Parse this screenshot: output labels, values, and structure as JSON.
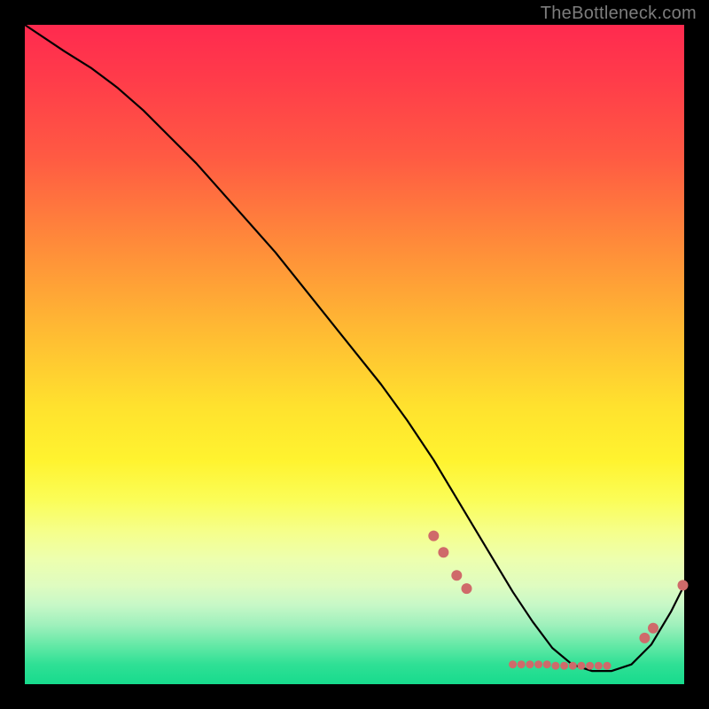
{
  "watermark": "TheBottleneck.com",
  "chart_data": {
    "type": "line",
    "title": "",
    "xlabel": "",
    "ylabel": "",
    "xlim": [
      0,
      100
    ],
    "ylim": [
      0,
      100
    ],
    "curve": {
      "name": "bottleneck-curve",
      "x": [
        0,
        6,
        10,
        14,
        18,
        22,
        26,
        30,
        34,
        38,
        42,
        46,
        50,
        54,
        58,
        62,
        65,
        68,
        71,
        74,
        77,
        80,
        83,
        86,
        89,
        92,
        95,
        98,
        100
      ],
      "y": [
        100,
        96,
        93.5,
        90.5,
        87,
        83,
        79,
        74.5,
        70,
        65.5,
        60.5,
        55.5,
        50.5,
        45.5,
        40,
        34,
        29,
        24,
        19,
        14,
        9.5,
        5.5,
        3,
        2,
        2,
        3,
        6,
        11,
        15
      ]
    },
    "dot_clusters": [
      {
        "name": "left-transition-cluster",
        "points": [
          {
            "x": 62.0,
            "y": 22.5
          },
          {
            "x": 63.5,
            "y": 20.0
          },
          {
            "x": 65.5,
            "y": 16.5
          },
          {
            "x": 67.0,
            "y": 14.5
          }
        ]
      },
      {
        "name": "valley-label-cluster",
        "points": [
          {
            "x": 74.0,
            "y": 3.0
          },
          {
            "x": 75.3,
            "y": 3.0
          },
          {
            "x": 76.6,
            "y": 3.0
          },
          {
            "x": 77.9,
            "y": 3.0
          },
          {
            "x": 79.2,
            "y": 3.0
          },
          {
            "x": 80.5,
            "y": 2.8
          },
          {
            "x": 81.8,
            "y": 2.8
          },
          {
            "x": 83.1,
            "y": 2.8
          },
          {
            "x": 84.4,
            "y": 2.8
          },
          {
            "x": 85.7,
            "y": 2.8
          },
          {
            "x": 87.0,
            "y": 2.8
          },
          {
            "x": 88.3,
            "y": 2.8
          }
        ]
      },
      {
        "name": "right-rise-cluster",
        "points": [
          {
            "x": 94.0,
            "y": 7.0
          },
          {
            "x": 95.3,
            "y": 8.5
          },
          {
            "x": 99.8,
            "y": 15.0
          }
        ]
      }
    ],
    "colors": {
      "curve": "#000000",
      "dots": "#cf6a6a"
    }
  }
}
